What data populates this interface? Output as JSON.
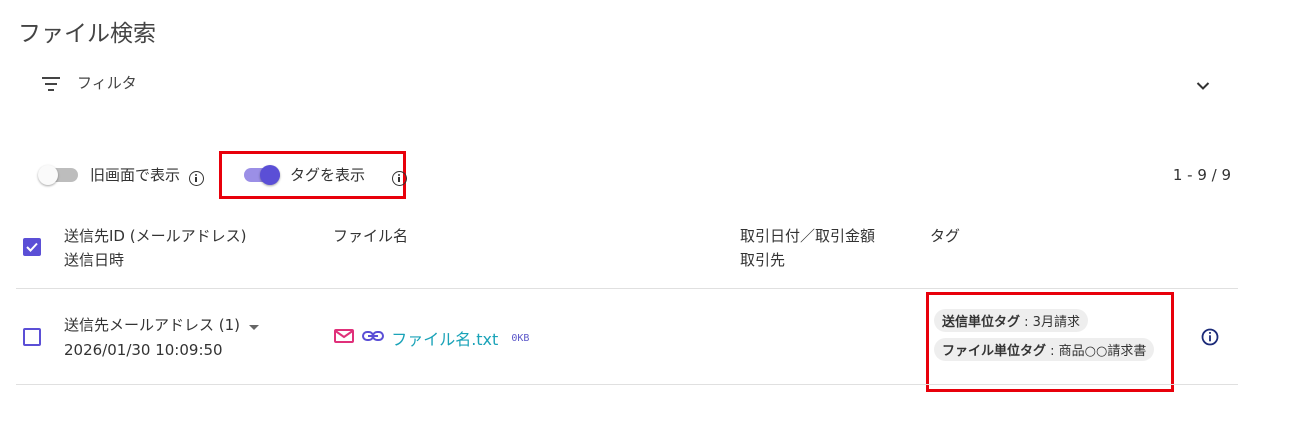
{
  "page": {
    "title": "ファイル検索"
  },
  "filter": {
    "label": "フィルタ",
    "icon": "filter-list-icon",
    "expand_icon": "chevron-down-icon"
  },
  "toggles": {
    "old_view": {
      "label": "旧画面で表示",
      "on": false
    },
    "show_tags": {
      "label": "タグを表示",
      "on": true
    }
  },
  "pagination": {
    "range": "1 - 9 / 9"
  },
  "table": {
    "headers": {
      "recipient_line1": "送信先ID (メールアドレス)",
      "recipient_line2": "送信日時",
      "file_name": "ファイル名",
      "deal_line1": "取引日付／取引金額",
      "deal_line2": "取引先",
      "tags": "タグ"
    },
    "rows": [
      {
        "recipient": "送信先メールアドレス (1)",
        "sent_at": "2026/01/30 10:09:50",
        "file_name": "ファイル名.txt",
        "file_size": "0KB",
        "tags": [
          {
            "key": "送信単位タグ",
            "value": "3月請求"
          },
          {
            "key": "ファイル単位タグ",
            "value": "商品○○請求書"
          }
        ]
      }
    ]
  },
  "colors": {
    "accent": "#5b4fd6",
    "accent_track": "#9b8fe6",
    "highlight": "#e8000b",
    "mail_icon": "#e0307a",
    "link": "#1aa3b8",
    "info_action": "#1b2a78"
  }
}
